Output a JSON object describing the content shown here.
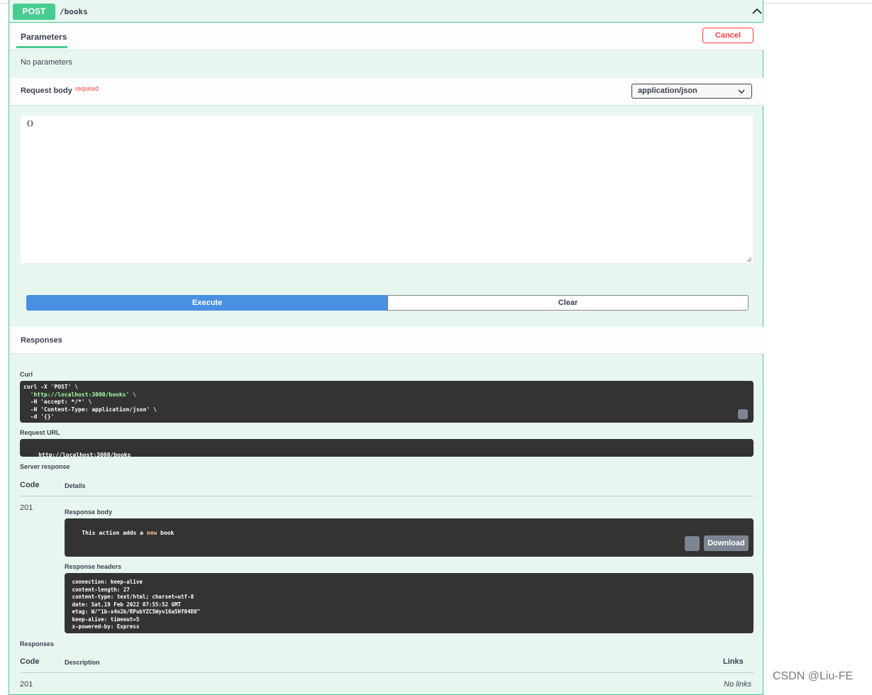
{
  "endpoint": {
    "method": "POST",
    "path": "/books"
  },
  "parameters": {
    "tab_label": "Parameters",
    "cancel_label": "Cancel",
    "empty_text": "No parameters"
  },
  "request_body": {
    "title": "Request body",
    "required_label": "required",
    "content_type": "application/json",
    "value": "{}"
  },
  "actions": {
    "execute_label": "Execute",
    "clear_label": "Clear"
  },
  "responses_section_title": "Responses",
  "curl": {
    "label": "Curl",
    "lines": [
      "curl -X 'POST' \\",
      "  'http://localhost:3000/books' \\",
      "  -H 'accept: */*' \\",
      "  -H 'Content-Type: application/json' \\",
      "  -d '{}'"
    ]
  },
  "request_url": {
    "label": "Request URL",
    "value": "http://localhost:3000/books"
  },
  "server_response": {
    "label": "Server response",
    "col_code": "Code",
    "col_details": "Details",
    "code": "201",
    "body_label": "Response body",
    "body_prefix": "This action adds a ",
    "body_keyword": "new",
    "body_suffix": " book",
    "download_label": "Download",
    "headers_label": "Response headers",
    "headers": [
      " connection: keep-alive ",
      " content-length: 27 ",
      " content-type: text/html; charset=utf-8 ",
      " date: Sat,19 Feb 2022 07:55:52 GMT ",
      " etag: W/\"1b-x4n2b/RPubYZC5Wyv16a5Hf04D8\" ",
      " keep-alive: timeout=5 ",
      " x-powered-by: Express "
    ]
  },
  "responses_table": {
    "label": "Responses",
    "col_code": "Code",
    "col_description": "Description",
    "col_links": "Links",
    "code": "201",
    "links_value": "No links"
  },
  "watermark": "CSDN @Liu-FE"
}
